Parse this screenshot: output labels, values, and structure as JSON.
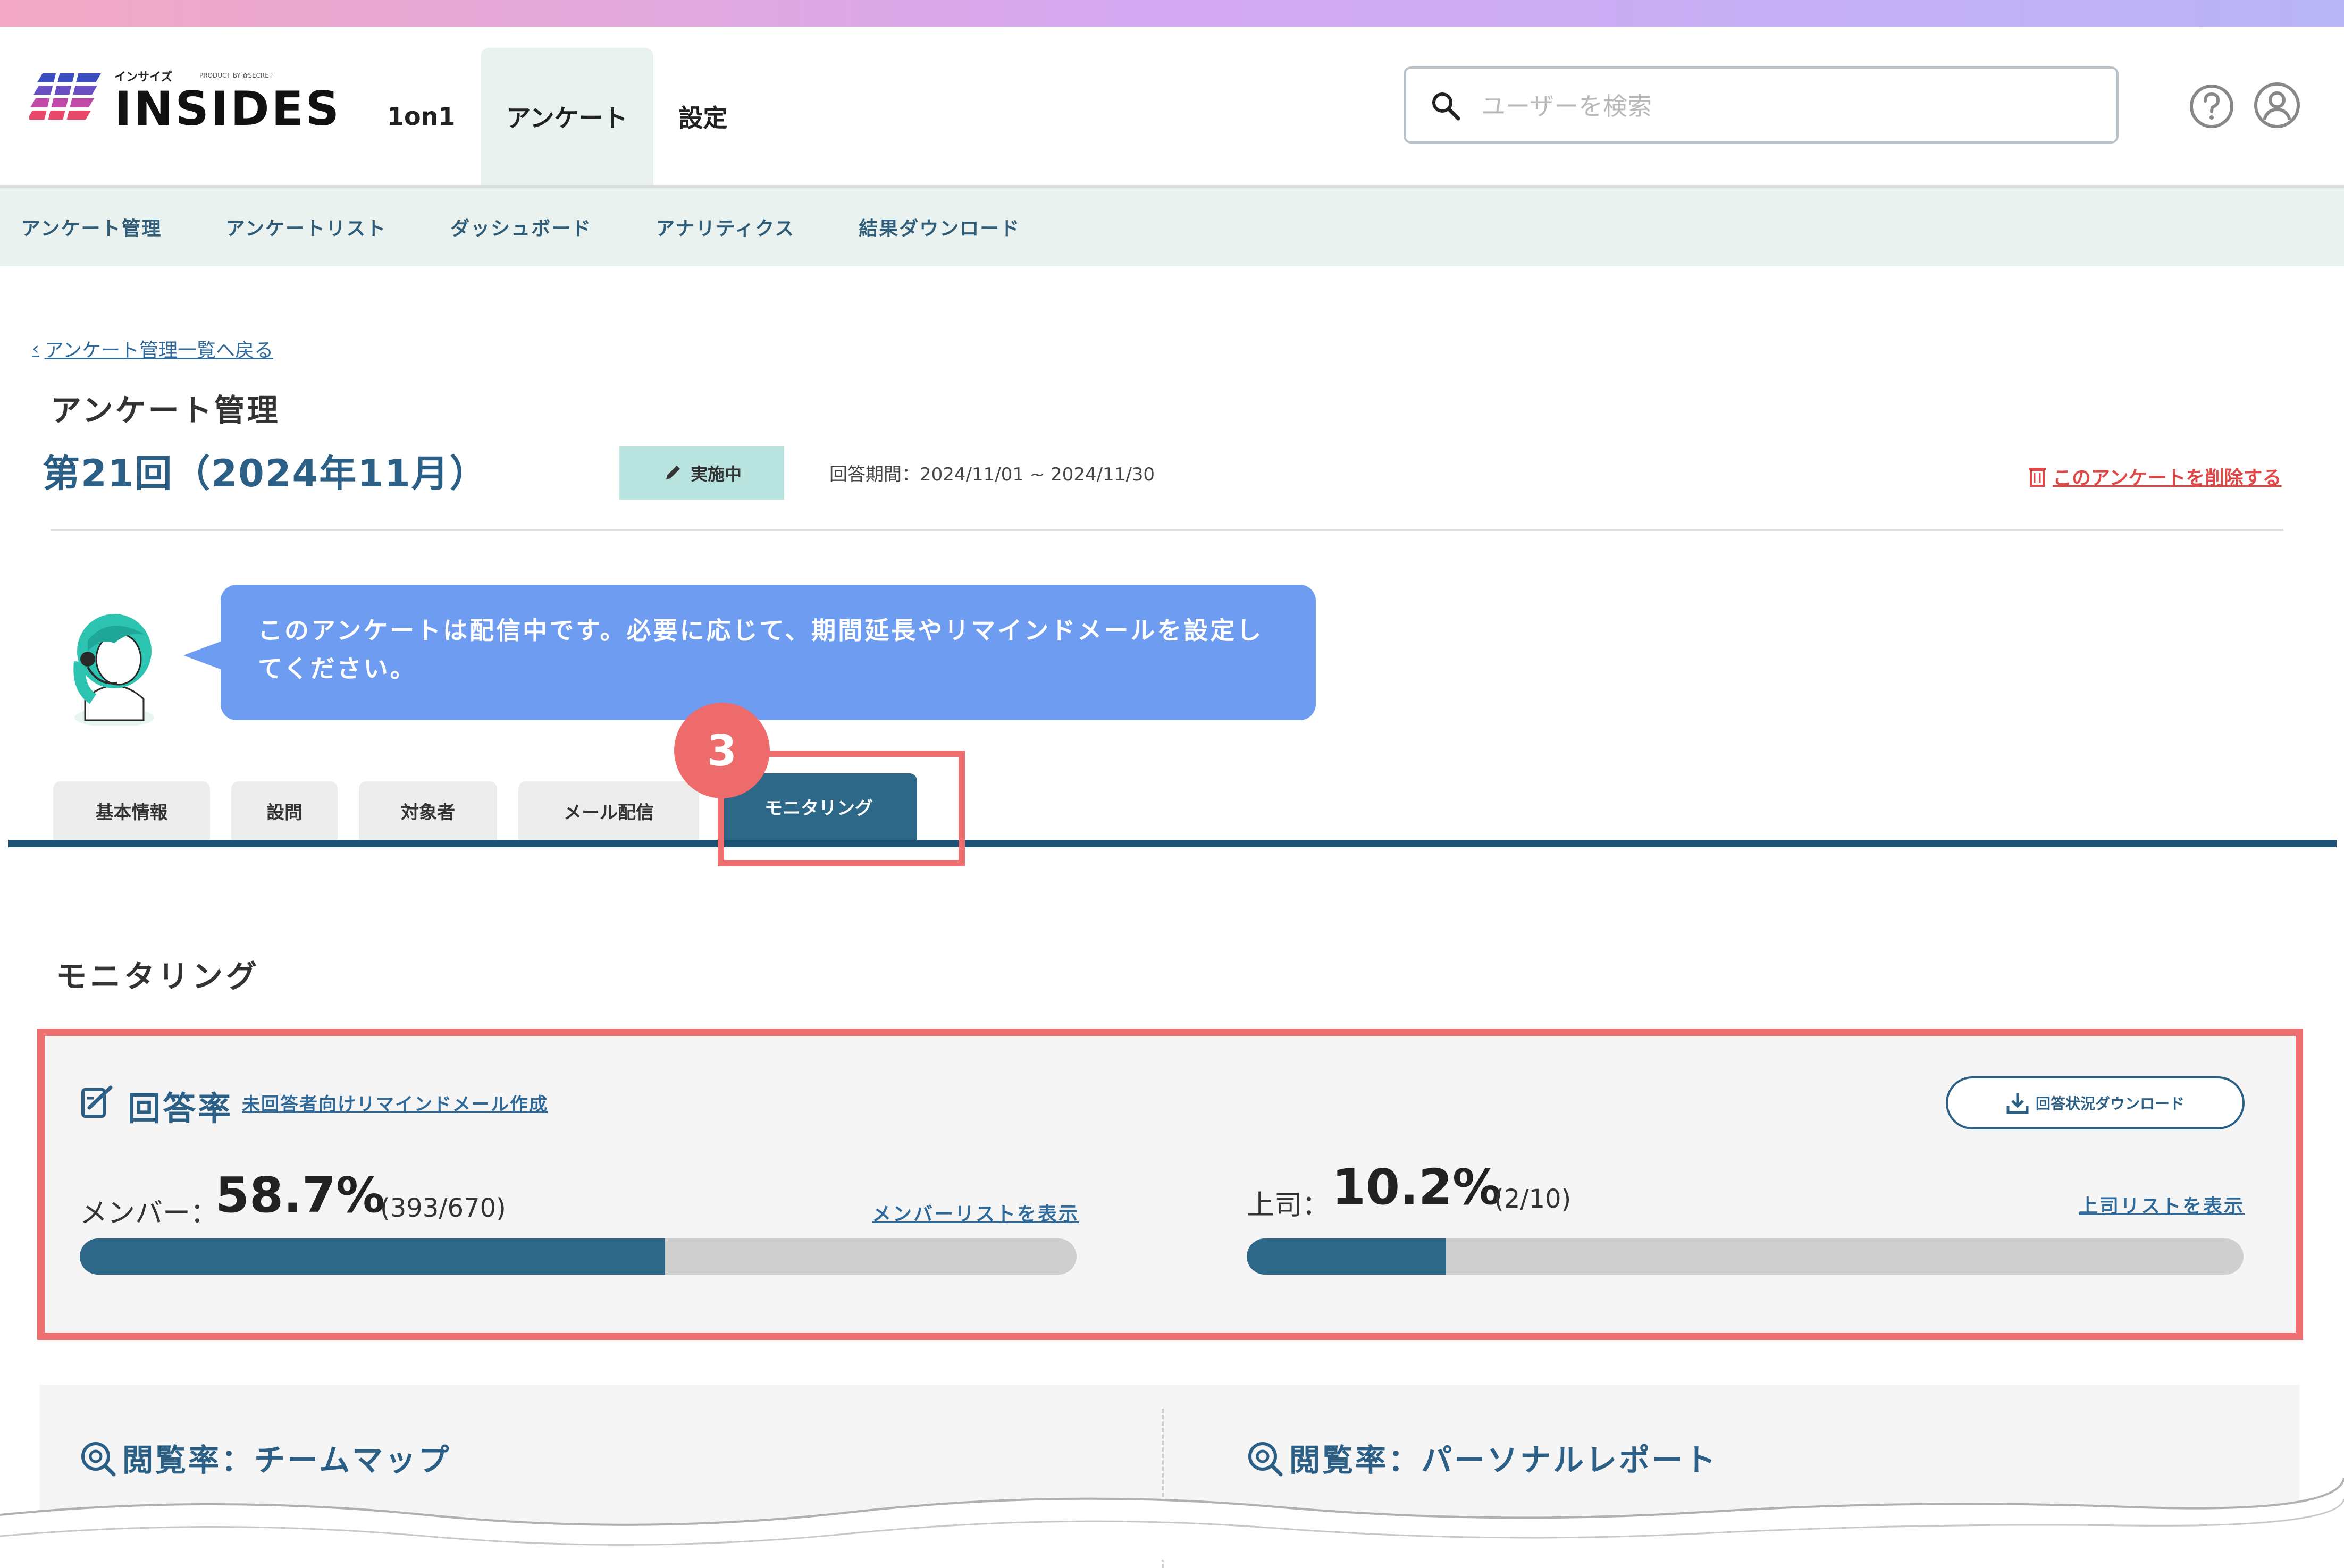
{
  "header": {
    "logo_kana": "インサイズ",
    "logo_product": "PRODUCT BY ✿SECRET",
    "logo_word": "INSIDES",
    "nav": [
      "1on1",
      "アンケート",
      "設定"
    ],
    "active_nav": "アンケート",
    "search_placeholder": "ユーザーを検索"
  },
  "subnav": [
    "アンケート管理",
    "アンケートリスト",
    "ダッシュボード",
    "アナリティクス",
    "結果ダウンロード"
  ],
  "page": {
    "back_link": "アンケート管理一覧へ戻る",
    "title": "アンケート管理",
    "survey_name": "第21回（2024年11月）",
    "status": "実施中",
    "period": "回答期間：2024/11/01 ~ 2024/11/30",
    "delete_link": "このアンケートを削除する"
  },
  "assistant_message": "このアンケートは配信中です。必要に応じて、期間延長やリマインドメールを設定してください。",
  "tabs": [
    "基本情報",
    "設問",
    "対象者",
    "メール配信",
    "モニタリング"
  ],
  "active_tab": "モニタリング",
  "step_number": "3",
  "monitoring": {
    "section_title": "モニタリング",
    "card_title": "回答率",
    "remind_link": "未回答者向けリマインドメール作成",
    "download_button": "回答状況ダウンロード",
    "member": {
      "label": "メンバー：",
      "rate": "58.7%",
      "count": "(393/670)",
      "fraction": 0.587,
      "list_link": "メンバーリストを表示"
    },
    "boss": {
      "label": "上司：",
      "rate": "10.2%",
      "count": "(2/10)",
      "fraction": 0.2,
      "list_link": "上司リストを表示"
    }
  },
  "lower": {
    "left_title": "閲覧率：チームマップ",
    "right_title": "閲覧率：パーソナルレポート"
  },
  "colors": {
    "brand_blue": "#2b5f86",
    "tab_active": "#2d6888",
    "highlight_red": "#ee6f6f",
    "subnav_bg": "#e9f2ef",
    "bubble_blue": "#6e9cf0"
  }
}
